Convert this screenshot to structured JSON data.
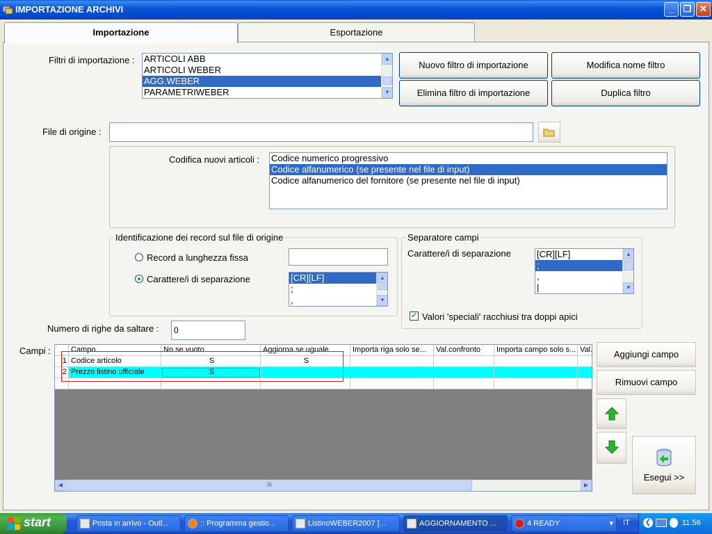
{
  "window": {
    "title": "IMPORTAZIONE ARCHIVI"
  },
  "tabs": [
    {
      "label": "Importazione",
      "active": true
    },
    {
      "label": "Esportazione",
      "active": false
    }
  ],
  "filters": {
    "label": "Filtri di importazione :",
    "items": [
      "ARTICOLI ABB",
      "ARTICOLI WEBER",
      "AGG.WEBER",
      "PARAMETRIWEBER"
    ],
    "selected_index": 2
  },
  "buttons": {
    "new_filter": "Nuovo filtro di importazione",
    "rename_filter": "Modifica nome filtro",
    "delete_filter": "Elimina filtro di importazione",
    "duplicate_filter": "Duplica filtro",
    "add_field": "Aggiungi campo",
    "remove_field": "Rimuovi campo",
    "execute": "Esegui >>"
  },
  "source_file": {
    "label": "File di origine :",
    "value": ""
  },
  "encoding": {
    "label": "Codifica nuovi articoli :",
    "options": [
      "Codice numerico progressivo",
      "Codice alfanumerico (se presente nel file di input)",
      "Codice alfanumerico del fornitore (se presente nel file di input)"
    ],
    "selected_index": 1
  },
  "record_id": {
    "title": "Identificazione dei record sul file di origine",
    "fixed_length_label": "Record a lunghezza fissa",
    "fixed_length_value": "",
    "separator_label": "Carattere/i di separazione",
    "separator_items": [
      "[CR][LF]",
      ";",
      ","
    ],
    "separator_selected": 0,
    "mode": "separator"
  },
  "field_sep": {
    "title": "Separatore campi",
    "label": "Carattere/i di separazione",
    "items": [
      "[CR][LF]",
      ";",
      ",",
      "|"
    ],
    "selected_index": 1,
    "quoted_label": "Valori 'speciali' racchiusi tra doppi apici",
    "quoted_checked": true
  },
  "skip_rows": {
    "label": "Numero di righe da saltare :",
    "value": "0"
  },
  "fields": {
    "label": "Campi :",
    "columns": [
      "Campo",
      "No se vuoto",
      "Aggiorna se uguale",
      "Importa riga solo se...",
      "Val.confronto",
      "Importa campo solo s...",
      "Val."
    ],
    "rows": [
      {
        "num": "1",
        "campo": "Codice articolo",
        "no_se_vuoto": "S",
        "aggiorna": "S",
        "importa_riga": "",
        "val_confronto": "",
        "importa_campo": "",
        "val": ""
      },
      {
        "num": "2",
        "campo": "Prezzo listino ufficiale",
        "no_se_vuoto": "S",
        "aggiorna": "",
        "importa_riga": "",
        "val_confronto": "",
        "importa_campo": "",
        "val": ""
      }
    ],
    "selected_row": 1,
    "scroll_marker": "III"
  },
  "taskbar": {
    "start_label": "start",
    "tasks": [
      "Posta in arrivo - Outl...",
      ":: Programma gestio...",
      "ListinoWEBER2007  [...",
      "AGGIORNAMENTO  ...",
      "4 READY"
    ],
    "language": "IT",
    "clock": "11.56"
  },
  "colors": {
    "title_bar": "#0a55d6",
    "selection": "#316ac5",
    "grid_selected_row": "#00ffff",
    "annotation_box": "#e02020",
    "taskbar": "#2157d7",
    "start": "#3b9d3b"
  }
}
